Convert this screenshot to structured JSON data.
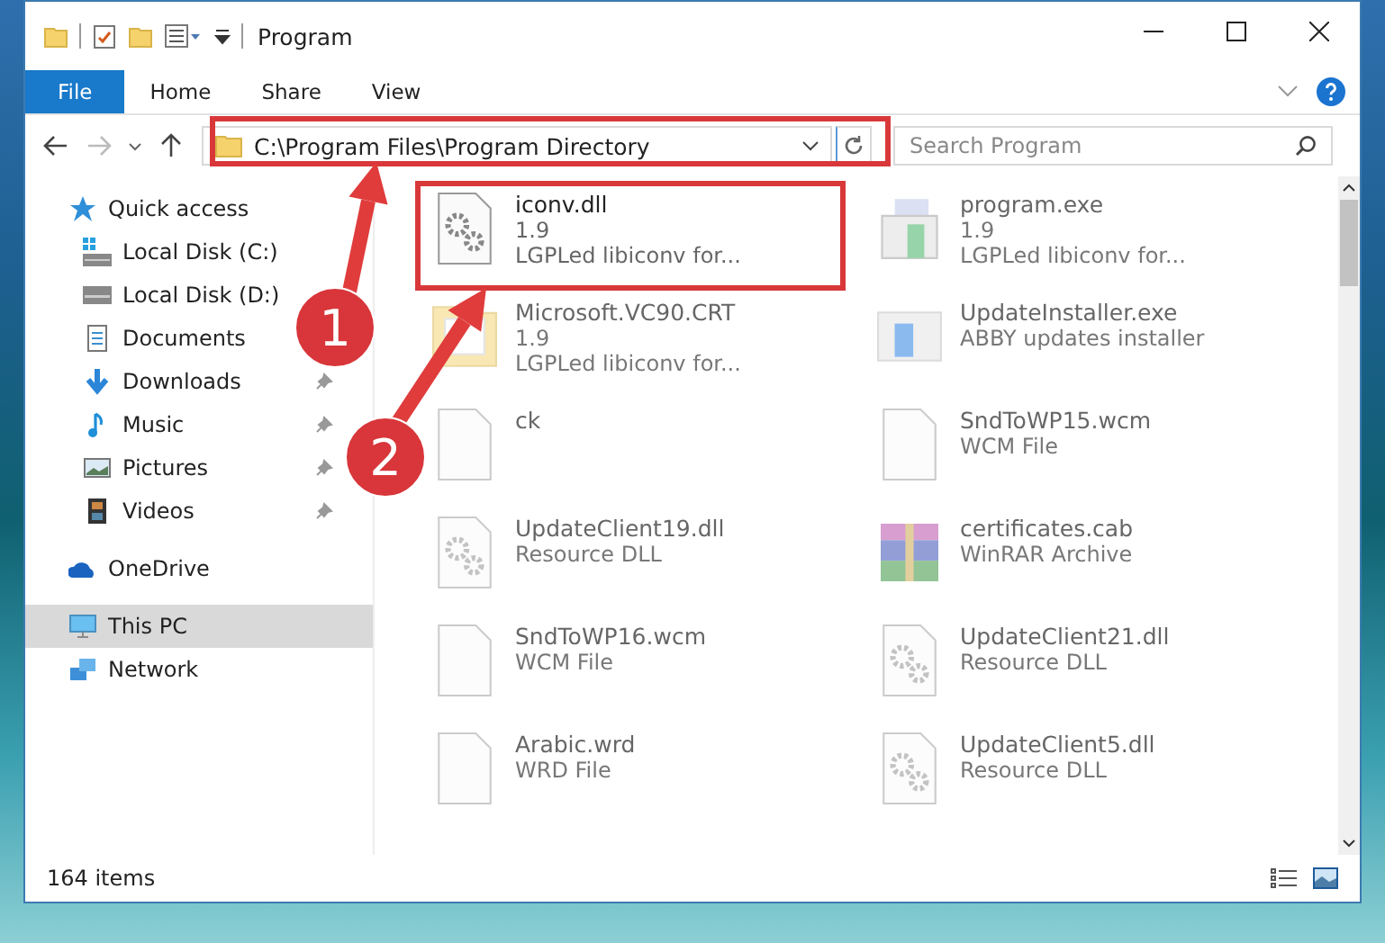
{
  "window": {
    "title": "Program"
  },
  "ribbon_tabs": [
    {
      "label": "File",
      "selected": true
    },
    {
      "label": "Home",
      "selected": false
    },
    {
      "label": "Share",
      "selected": false
    },
    {
      "label": "View",
      "selected": false
    }
  ],
  "address": {
    "value": "C:\\Program Files\\Program Directory"
  },
  "search": {
    "placeholder": "Search Program"
  },
  "sidebar": {
    "items": [
      {
        "label": "Quick access",
        "kind": "star",
        "selected": false,
        "pinned": false,
        "children": [
          {
            "label": "Local Disk (C:)",
            "kind": "sysdisk",
            "selected": false,
            "pinned": false
          },
          {
            "label": "Local Disk (D:)",
            "kind": "disk",
            "selected": false,
            "pinned": false
          },
          {
            "label": "Documents",
            "kind": "docs",
            "selected": false,
            "pinned": false
          },
          {
            "label": "Downloads",
            "kind": "download",
            "selected": false,
            "pinned": true
          },
          {
            "label": "Music",
            "kind": "music",
            "selected": false,
            "pinned": true
          },
          {
            "label": "Pictures",
            "kind": "pictures",
            "selected": false,
            "pinned": true
          },
          {
            "label": "Videos",
            "kind": "videos",
            "selected": false,
            "pinned": true
          }
        ]
      },
      {
        "label": "OneDrive",
        "kind": "cloud",
        "selected": false,
        "pinned": false
      },
      {
        "label": "This PC",
        "kind": "pc",
        "selected": true,
        "pinned": false
      },
      {
        "label": "Network",
        "kind": "network",
        "selected": false,
        "pinned": false
      }
    ]
  },
  "files": [
    {
      "name": "iconv.dll",
      "lines": [
        "1.9",
        "LGPLed libiconv for..."
      ],
      "kind": "dll",
      "dimmed": false
    },
    {
      "name": "program.exe",
      "lines": [
        "1.9",
        "LGPLed libiconv for..."
      ],
      "kind": "exe",
      "dimmed": true
    },
    {
      "name": "Microsoft.VC90.CRT",
      "lines": [
        "1.9",
        "LGPLed libiconv for..."
      ],
      "kind": "folder",
      "dimmed": true
    },
    {
      "name": "UpdateInstaller.exe",
      "lines": [
        "ABBY updates installer"
      ],
      "kind": "installer",
      "dimmed": true
    },
    {
      "name": "ck",
      "kind": "blank",
      "dimmed": true
    },
    {
      "name": "SndToWP15.wcm",
      "lines": [
        "WCM File"
      ],
      "kind": "blank",
      "dimmed": true
    },
    {
      "name": "UpdateClient19.dll",
      "lines": [
        "Resource DLL"
      ],
      "kind": "dll",
      "dimmed": true
    },
    {
      "name": "certificates.cab",
      "lines": [
        "WinRAR Archive"
      ],
      "kind": "archive",
      "dimmed": true
    },
    {
      "name": "SndToWP16.wcm",
      "lines": [
        "WCM File"
      ],
      "kind": "blank",
      "dimmed": true
    },
    {
      "name": "UpdateClient21.dll",
      "lines": [
        "Resource DLL"
      ],
      "kind": "dll",
      "dimmed": true
    },
    {
      "name": "Arabic.wrd",
      "lines": [
        "WRD File"
      ],
      "kind": "blank",
      "dimmed": true
    },
    {
      "name": "UpdateClient5.dll",
      "lines": [
        "Resource DLL"
      ],
      "kind": "dll",
      "dimmed": true
    }
  ],
  "status_bar": {
    "count": "164 items"
  },
  "annotations": [
    {
      "number": "1"
    },
    {
      "number": "2"
    }
  ]
}
